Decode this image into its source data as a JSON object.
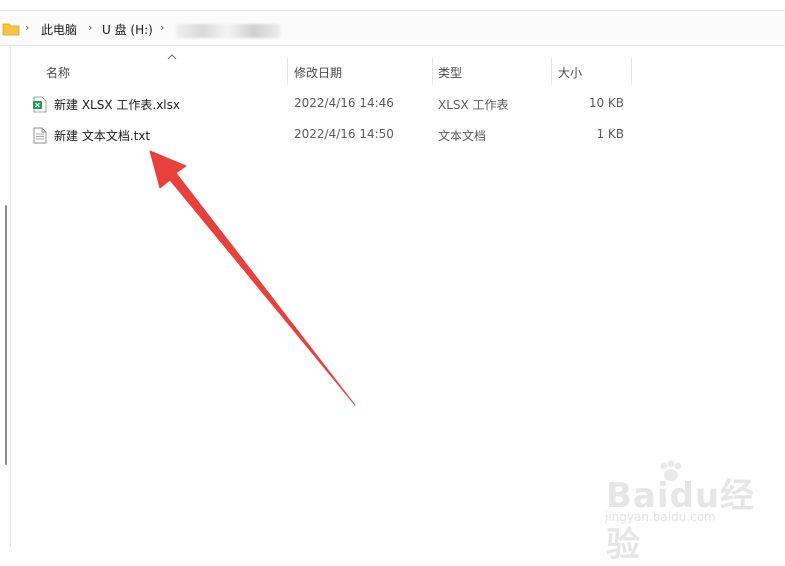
{
  "breadcrumb": {
    "items": [
      "此电脑",
      "U 盘 (H:)"
    ],
    "separator": "›"
  },
  "columns": {
    "name": "名称",
    "date": "修改日期",
    "type": "类型",
    "size": "大小"
  },
  "files": [
    {
      "name": "新建 XLSX 工作表.xlsx",
      "date": "2022/4/16 14:46",
      "type": "XLSX 工作表",
      "size": "10 KB",
      "icon": "xlsx-file-icon"
    },
    {
      "name": "新建 文本文档.txt",
      "date": "2022/4/16 14:50",
      "type": "文本文档",
      "size": "1 KB",
      "icon": "txt-file-icon"
    }
  ],
  "watermark": {
    "brand": "Baidu经验",
    "url": "jingyan.baidu.com"
  },
  "colors": {
    "folder": "#f5c542",
    "xlsx": "#1f9d55",
    "arrow": "#e8403a"
  }
}
